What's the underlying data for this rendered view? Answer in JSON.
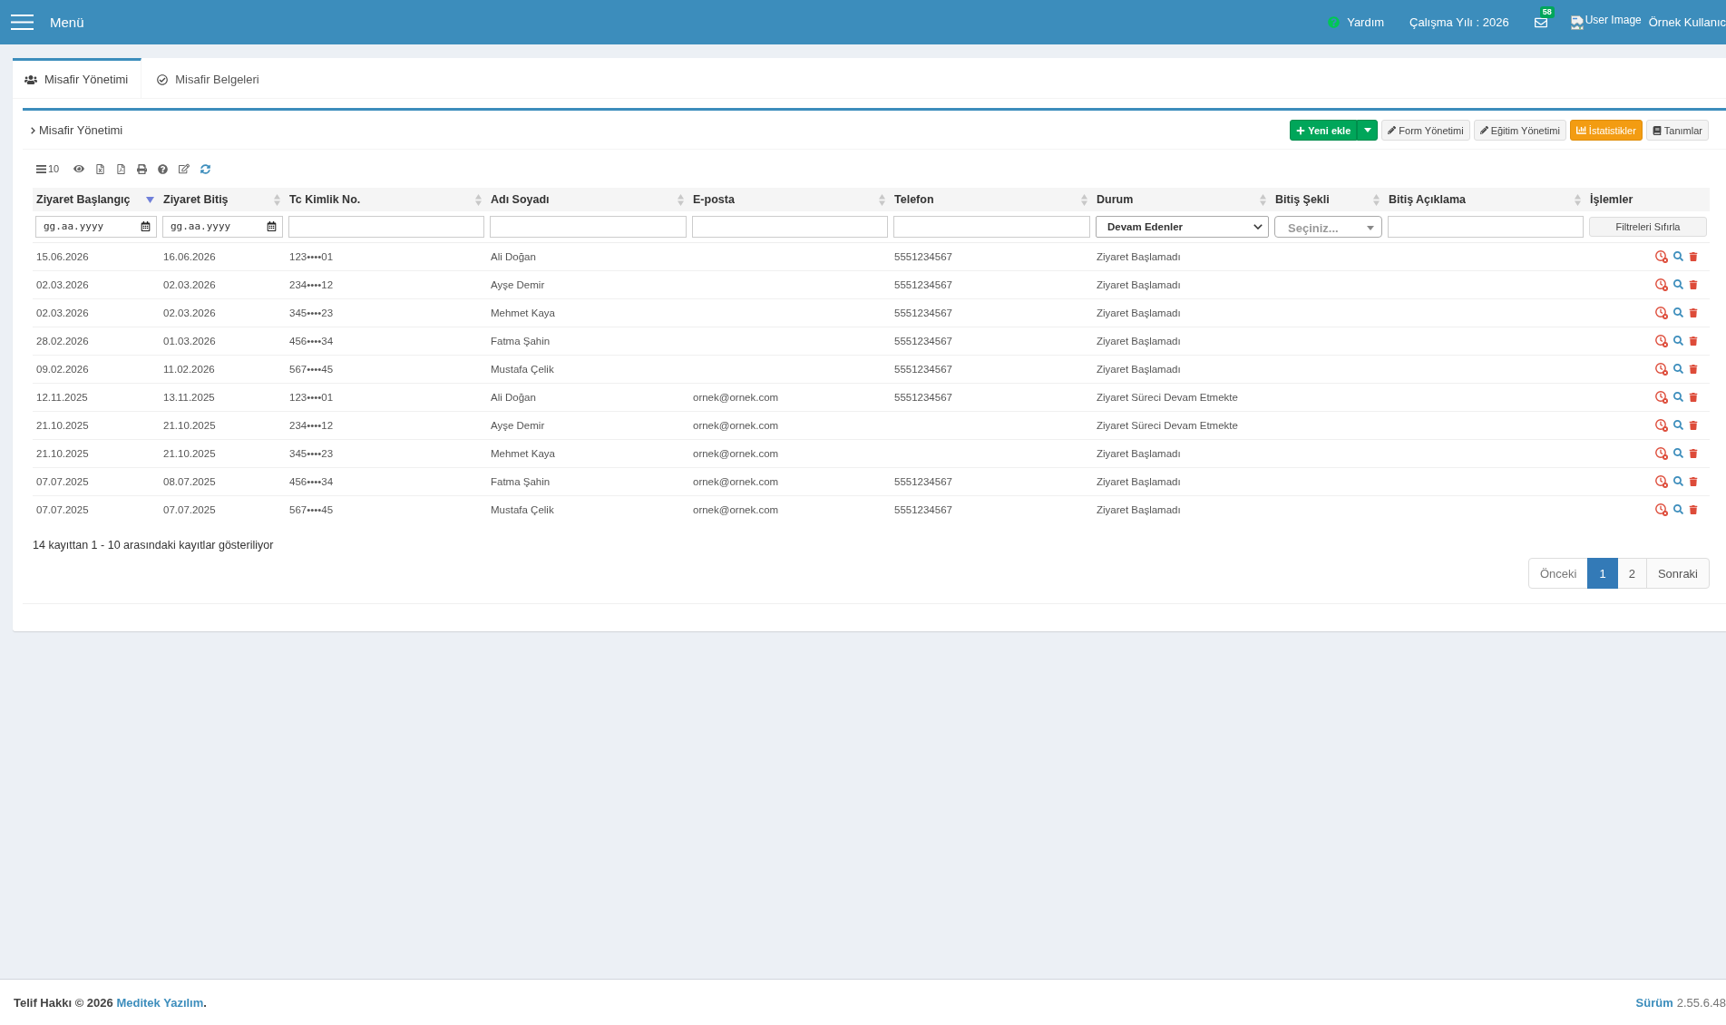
{
  "header": {
    "menu_label": "Menü",
    "help_label": "Yardım",
    "work_year": "Çalışma Yılı : 2026",
    "mail_badge": "58",
    "user_image_alt": "User Image",
    "user_name": "Örnek Kullanıc"
  },
  "tabs": [
    {
      "label": "Misafir Yönetimi",
      "selected": true
    },
    {
      "label": "Misafir Belgeleri",
      "selected": false
    }
  ],
  "panel": {
    "title": "Misafir Yönetimi",
    "actions": [
      {
        "label": "Yeni ekle",
        "kind": "success",
        "split": true
      },
      {
        "label": "Form Yönetimi",
        "kind": "default",
        "split": false
      },
      {
        "label": "Eğitim Yönetimi",
        "kind": "default",
        "split": false
      },
      {
        "label": "İstatistikler",
        "kind": "warning",
        "split": false
      },
      {
        "label": "Tanımlar",
        "kind": "default",
        "split": false
      }
    ]
  },
  "toolbar": {
    "page_size": "10"
  },
  "table": {
    "columns": [
      {
        "label": "Ziyaret Başlangıç",
        "sortable": true,
        "sorted": true
      },
      {
        "label": "Ziyaret Bitiş",
        "sortable": true,
        "sorted": false
      },
      {
        "label": "Tc Kimlik No.",
        "sortable": true,
        "sorted": false
      },
      {
        "label": "Adı Soyadı",
        "sortable": true,
        "sorted": false
      },
      {
        "label": "E-posta",
        "sortable": true,
        "sorted": false
      },
      {
        "label": "Telefon",
        "sortable": true,
        "sorted": false
      },
      {
        "label": "Durum",
        "sortable": true,
        "sorted": false
      },
      {
        "label": "Bitiş Şekli",
        "sortable": true,
        "sorted": false
      },
      {
        "label": "Bitiş Açıklama",
        "sortable": true,
        "sorted": false
      },
      {
        "label": "İşlemler",
        "sortable": false,
        "sorted": false
      }
    ],
    "filters": [
      {
        "kind": "date",
        "placeholder": "gg.aa.yyyy"
      },
      {
        "kind": "date",
        "placeholder": "gg.aa.yyyy"
      },
      {
        "kind": "text"
      },
      {
        "kind": "text"
      },
      {
        "kind": "text"
      },
      {
        "kind": "text"
      },
      {
        "kind": "select",
        "value": "Devam Edenler"
      },
      {
        "kind": "combo",
        "placeholder": "Seçiniz..."
      },
      {
        "kind": "text"
      },
      {
        "kind": "button",
        "label": "Filtreleri Sıfırla"
      }
    ],
    "rows": [
      {
        "start": "15.06.2026",
        "end": "16.06.2026",
        "tc_no": "123••••01",
        "name": "Ali Doğan",
        "phone": "5551234567",
        "status": "Ziyaret Başlamadı"
      },
      {
        "start": "02.03.2026",
        "end": "02.03.2026",
        "tc_no": "234••••12",
        "name": "Ayşe Demir",
        "phone": "5551234567",
        "status": "Ziyaret Başlamadı"
      },
      {
        "start": "02.03.2026",
        "end": "02.03.2026",
        "tc_no": "345••••23",
        "name": "Mehmet Kaya",
        "phone": "5551234567",
        "status": "Ziyaret Başlamadı"
      },
      {
        "start": "28.02.2026",
        "end": "01.03.2026",
        "tc_no": "456••••34",
        "name": "Fatma Şahin",
        "phone": "5551234567",
        "status": "Ziyaret Başlamadı"
      },
      {
        "start": "09.02.2026",
        "end": "11.02.2026",
        "tc_no": "567••••45",
        "name": "Mustafa Çelik",
        "phone": "5551234567",
        "status": "Ziyaret Başlamadı"
      },
      {
        "start": "12.11.2025",
        "end": "13.11.2025",
        "tc_no": "123••••01",
        "name": "Ali Doğan",
        "email": "ornek@ornek.com",
        "phone": "5551234567",
        "status": "Ziyaret Süreci Devam Etmekte"
      },
      {
        "start": "21.10.2025",
        "end": "21.10.2025",
        "tc_no": "234••••12",
        "name": "Ayşe Demir",
        "email": "ornek@ornek.com",
        "status": "Ziyaret Süreci Devam Etmekte"
      },
      {
        "start": "21.10.2025",
        "end": "21.10.2025",
        "tc_no": "345••••23",
        "name": "Mehmet Kaya",
        "email": "ornek@ornek.com",
        "status": "Ziyaret Başlamadı"
      },
      {
        "start": "07.07.2025",
        "end": "08.07.2025",
        "tc_no": "456••••34",
        "name": "Fatma Şahin",
        "email": "ornek@ornek.com",
        "phone": "5551234567",
        "status": "Ziyaret Başlamadı"
      },
      {
        "start": "07.07.2025",
        "end": "07.07.2025",
        "tc_no": "567••••45",
        "name": "Mustafa Çelik",
        "email": "ornek@ornek.com",
        "phone": "5551234567",
        "status": "Ziyaret Başlamadı"
      }
    ]
  },
  "summary": "14 kayıttan 1 - 10 arasındaki kayıtlar gösteriliyor",
  "pagination": [
    {
      "label": "Önceki",
      "selected": false,
      "disabled": true
    },
    {
      "label": "1",
      "selected": true,
      "disabled": false
    },
    {
      "label": "2",
      "selected": false,
      "disabled": false
    },
    {
      "label": "Sonraki",
      "selected": false,
      "disabled": false
    }
  ],
  "footer": {
    "copyright": "Telif Hakkı © 2026",
    "company_link": "Meditek Yazılım",
    "copyright_end": ".",
    "version_label": "Sürüm",
    "version": "2.55.6.48"
  }
}
